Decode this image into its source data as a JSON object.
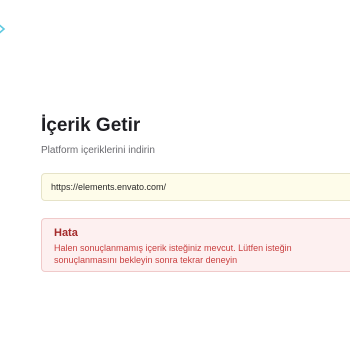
{
  "header": {
    "logo_icon": "envato-leaf-icon",
    "accent_color": "#82c341"
  },
  "main": {
    "title": "İçerik Getir",
    "subtitle": "Platform içeriklerini indirin",
    "url_input": {
      "value": "https://elements.envato.com/",
      "background": "#fefcea"
    },
    "error": {
      "title": "Hata",
      "message": "Halen sonuçlanmamış içerik isteğiniz mevcut. Lütfen isteğin sonuçlanmasını bekleyin sonra tekrar deneyin",
      "title_color": "#a42a2a",
      "text_color": "#c94040",
      "background": "#fdf0f0"
    }
  }
}
